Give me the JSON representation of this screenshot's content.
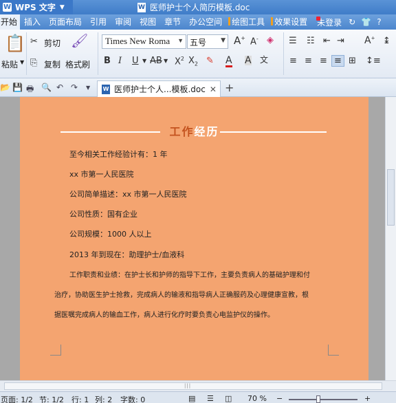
{
  "titlebar": {
    "app_name": "WPS 文字",
    "document_title": "医师护士个人简历模板.doc"
  },
  "menubar": {
    "items": [
      "开始",
      "插入",
      "页面布局",
      "引用",
      "审阅",
      "视图",
      "章节",
      "办公空间"
    ],
    "tagged_items": [
      "绘图工具",
      "效果设置"
    ],
    "login": "未登录"
  },
  "ribbon": {
    "paste": "粘贴",
    "cut": "剪切",
    "copy": "复制",
    "format_painter": "格式刷",
    "font_name": "Times New Roma",
    "font_size": "五号"
  },
  "tabbar": {
    "doc_tab": "医师护士个人...模板.doc"
  },
  "document": {
    "heading_part1": "工作",
    "heading_part2": "经历",
    "lines": [
      "至今相关工作经验计有：1 年",
      "xx 市第一人民医院",
      "公司简单描述：xx 市第一人民医院",
      "公司性质：国有企业",
      "公司规模：1000 人以上",
      "2013 年到现在：助理护士/血液科",
      "工作职责和业绩：在护士长和护师的指导下工作，主要负责病人的基础护理和付",
      "治疗，协助医生护士抢救，完成病人的输液和指导病人正确服药及心理健康宣教，根",
      "据医嘱完成病人的输血工作，病人进行化疗时要负责心电监护仪的操作。"
    ]
  },
  "statusbar": {
    "page": "页面: 1/2",
    "section": "节: 1/2",
    "row": "行: 1",
    "col": "列: 2",
    "words": "字数: 0",
    "zoom": "70 %"
  },
  "colors": {
    "page_background": "#f4a470",
    "heading_accent": "#c4531f",
    "titlebar": "#3f7cc8"
  }
}
